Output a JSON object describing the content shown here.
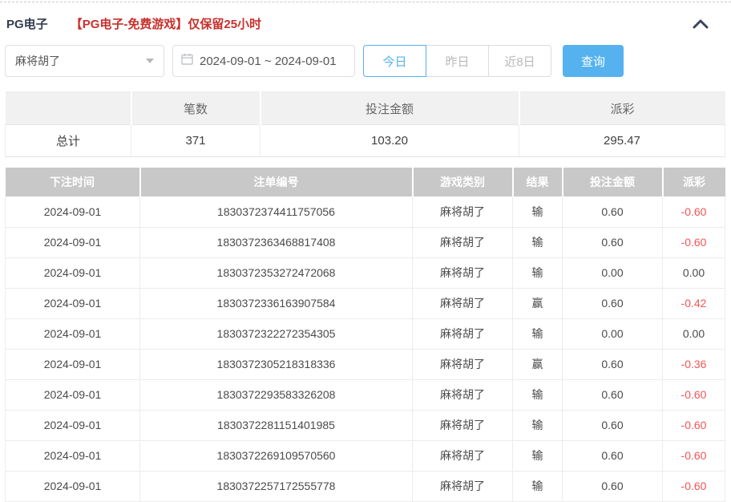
{
  "panel": {
    "title": "PG电子",
    "notice": "【PG电子-免费游戏】仅保留25小时"
  },
  "filters": {
    "game_select": {
      "value": "麻将胡了"
    },
    "date_range": {
      "value": "2024-09-01 ~ 2024-09-01"
    },
    "quick_buttons": [
      {
        "label": "今日",
        "active": true
      },
      {
        "label": "昨日",
        "active": false
      },
      {
        "label": "近8日",
        "active": false
      }
    ],
    "search_button": "查询"
  },
  "colors": {
    "accent_blue": "#55b2ef",
    "notice_red": "#c9302c",
    "negative_red": "#f25555",
    "header_gray": "#c8c8c8"
  },
  "summary": {
    "headers": [
      "",
      "笔数",
      "投注金额",
      "派彩"
    ],
    "row": {
      "label": "总计",
      "count": "371",
      "bet_amount": "103.20",
      "payout": "295.47"
    }
  },
  "table": {
    "headers": [
      "下注时间",
      "注单编号",
      "游戏类别",
      "结果",
      "投注金额",
      "派彩"
    ],
    "rows": [
      {
        "date": "2024-09-01",
        "order_id": "1830372374411757056",
        "game": "麻将胡了",
        "result": "输",
        "bet": "0.60",
        "payout": "-0.60",
        "negative": true
      },
      {
        "date": "2024-09-01",
        "order_id": "1830372363468817408",
        "game": "麻将胡了",
        "result": "输",
        "bet": "0.60",
        "payout": "-0.60",
        "negative": true
      },
      {
        "date": "2024-09-01",
        "order_id": "1830372353272472068",
        "game": "麻将胡了",
        "result": "输",
        "bet": "0.00",
        "payout": "0.00",
        "negative": false
      },
      {
        "date": "2024-09-01",
        "order_id": "1830372336163907584",
        "game": "麻将胡了",
        "result": "赢",
        "bet": "0.60",
        "payout": "-0.42",
        "negative": true
      },
      {
        "date": "2024-09-01",
        "order_id": "1830372322272354305",
        "game": "麻将胡了",
        "result": "输",
        "bet": "0.00",
        "payout": "0.00",
        "negative": false
      },
      {
        "date": "2024-09-01",
        "order_id": "1830372305218318336",
        "game": "麻将胡了",
        "result": "赢",
        "bet": "0.60",
        "payout": "-0.36",
        "negative": true
      },
      {
        "date": "2024-09-01",
        "order_id": "1830372293583326208",
        "game": "麻将胡了",
        "result": "输",
        "bet": "0.60",
        "payout": "-0.60",
        "negative": true
      },
      {
        "date": "2024-09-01",
        "order_id": "1830372281151401985",
        "game": "麻将胡了",
        "result": "输",
        "bet": "0.60",
        "payout": "-0.60",
        "negative": true
      },
      {
        "date": "2024-09-01",
        "order_id": "1830372269109570560",
        "game": "麻将胡了",
        "result": "输",
        "bet": "0.60",
        "payout": "-0.60",
        "negative": true
      },
      {
        "date": "2024-09-01",
        "order_id": "1830372257172555778",
        "game": "麻将胡了",
        "result": "输",
        "bet": "0.60",
        "payout": "-0.60",
        "negative": true
      }
    ]
  }
}
